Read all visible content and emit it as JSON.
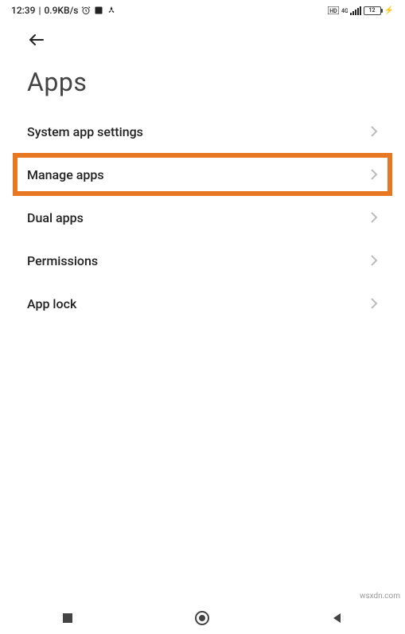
{
  "status": {
    "time": "12:39",
    "separator": "|",
    "speed": "0.9KB/s",
    "battery_level": "12",
    "charge_glyph": "⚡"
  },
  "header": {
    "title": "Apps"
  },
  "items": [
    {
      "label": "System app settings",
      "highlighted": false
    },
    {
      "label": "Manage apps",
      "highlighted": true
    },
    {
      "label": "Dual apps",
      "highlighted": false
    },
    {
      "label": "Permissions",
      "highlighted": false
    },
    {
      "label": "App lock",
      "highlighted": false
    }
  ],
  "watermark": "wsxdn.com"
}
